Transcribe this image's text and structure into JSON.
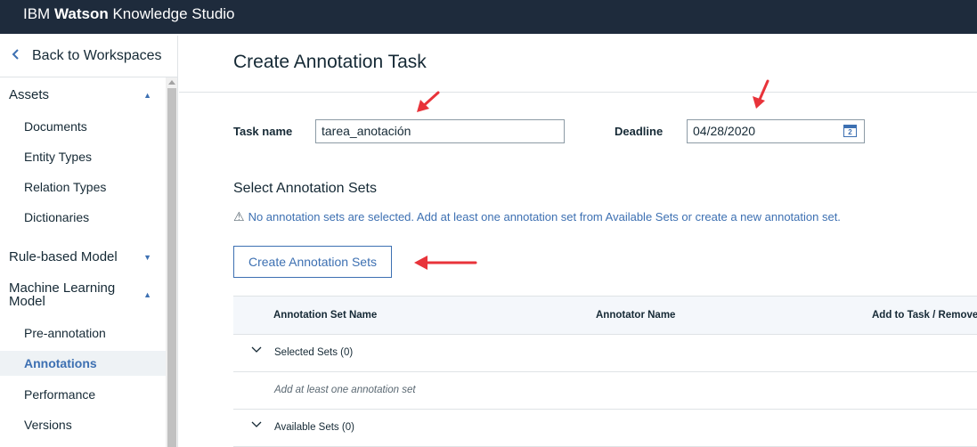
{
  "app": {
    "brand_light": "IBM",
    "brand_bold": "Watson",
    "brand_rest": "Knowledge Studio"
  },
  "sidebar": {
    "back_label": "Back to Workspaces",
    "sections": [
      {
        "label": "Assets",
        "caret": "▲",
        "items": [
          "Documents",
          "Entity Types",
          "Relation Types",
          "Dictionaries"
        ]
      },
      {
        "label": "Rule-based Model",
        "caret": "▼",
        "items": []
      },
      {
        "label": "Machine Learning Model",
        "caret": "▲",
        "items": [
          "Pre-annotation",
          "Annotations",
          "Performance",
          "Versions"
        ]
      }
    ],
    "active_item": "Annotations"
  },
  "main": {
    "title": "Create Annotation Task",
    "task_name_label": "Task name",
    "task_name_value": "tarea_anotación",
    "deadline_label": "Deadline",
    "deadline_value": "04/28/2020",
    "calendar_glyph": "2",
    "section_title": "Select Annotation Sets",
    "warning": "No annotation sets are selected. Add at least one annotation set from Available Sets or create a new annotation set.",
    "create_button": "Create Annotation Sets",
    "table": {
      "columns": [
        "Annotation Set Name",
        "Annotator Name",
        "Add to Task / Remove"
      ],
      "selected_group": "Selected Sets (0)",
      "empty_note": "Add at least one annotation set",
      "available_group": "Available Sets (0)"
    }
  },
  "colors": {
    "topbar": "#1e2b3c",
    "accent": "#3d70b2",
    "annotation_arrow": "#e8333a"
  }
}
